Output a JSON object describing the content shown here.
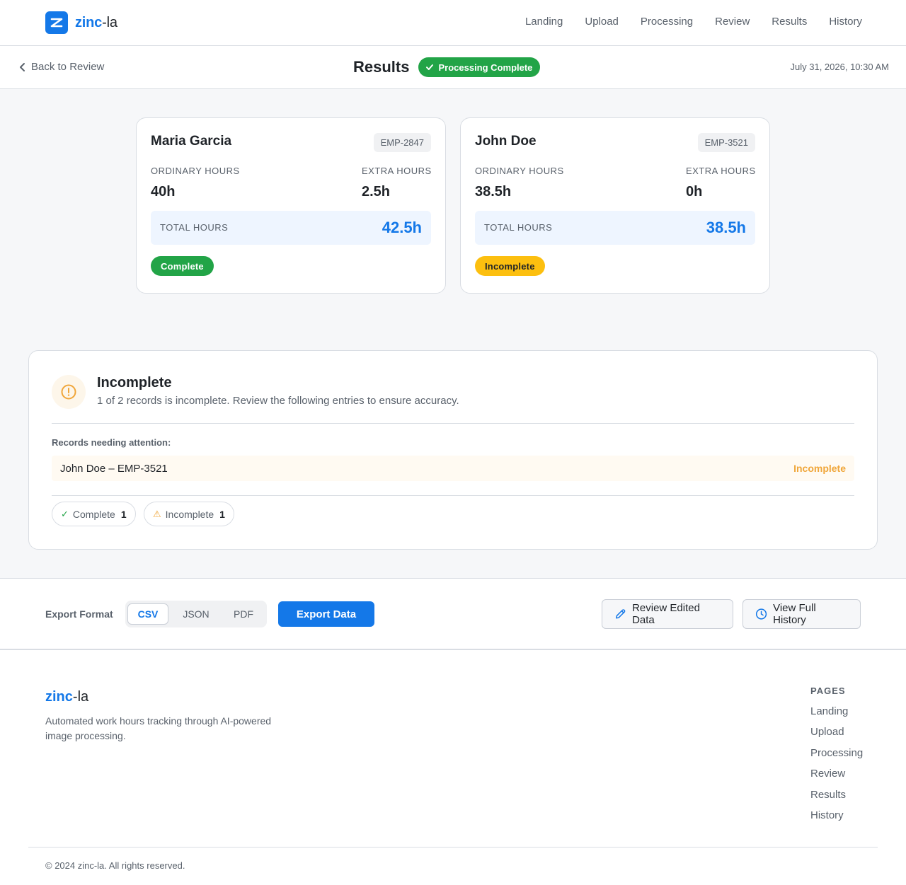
{
  "navbar": {
    "brand_primary": "zinc",
    "brand_secondary": "-la",
    "links": [
      "Landing",
      "Upload",
      "Processing",
      "Review",
      "Results",
      "History"
    ]
  },
  "subheader": {
    "back_label": "Back to Review",
    "title": "Results",
    "status": "Processing Complete",
    "timestamp": "July 31, 2026, 10:30 AM"
  },
  "employees": [
    {
      "name": "Maria Garcia",
      "id": "EMP-2847",
      "ordinary_label": "ORDINARY HOURS",
      "ordinary_value": "40h",
      "extra_label": "EXTRA HOURS",
      "extra_value": "2.5h",
      "total_label": "TOTAL HOURS",
      "total_value": "42.5h",
      "state": "Complete"
    },
    {
      "name": "John Doe",
      "id": "EMP-3521",
      "ordinary_label": "ORDINARY HOURS",
      "ordinary_value": "38.5h",
      "extra_label": "EXTRA HOURS",
      "extra_value": "0h",
      "total_label": "TOTAL HOURS",
      "total_value": "38.5h",
      "state": "Incomplete"
    }
  ],
  "warning": {
    "title": "Incomplete",
    "description": "1 of 2 records is incomplete. Review the following entries to ensure accuracy.",
    "attention_label": "Records needing attention:",
    "records": [
      {
        "name": "John Doe – EMP-3521",
        "status": "Incomplete"
      }
    ],
    "summary": {
      "complete_mark": "✓",
      "complete_label": "Complete",
      "complete_count": "1",
      "incomplete_mark": "⚠",
      "incomplete_label": "Incomplete",
      "incomplete_count": "1"
    }
  },
  "export": {
    "label": "Export Format",
    "formats": [
      "CSV",
      "JSON",
      "PDF"
    ],
    "selected": "CSV",
    "export_button": "Export Data",
    "review_button": "Review Edited Data",
    "history_button": "View Full History"
  },
  "footer": {
    "brand_primary": "zinc",
    "brand_secondary": "-la",
    "description": "Automated work hours tracking through AI-powered image processing.",
    "pages_title": "PAGES",
    "pages": [
      "Landing",
      "Upload",
      "Processing",
      "Review",
      "Results",
      "History"
    ],
    "copyright": "© 2024 zinc-la. All rights reserved."
  },
  "colors": {
    "accent": "#1478e8",
    "success": "#22a447",
    "warning": "#fcbf0f",
    "warning_text": "#f0a63a"
  },
  "icons": {
    "logo": "zinc-logo-icon",
    "back": "chevron-left-icon",
    "status": "check-icon",
    "warning": "alert-circle-icon",
    "review": "pencil-icon",
    "history": "clock-icon"
  }
}
